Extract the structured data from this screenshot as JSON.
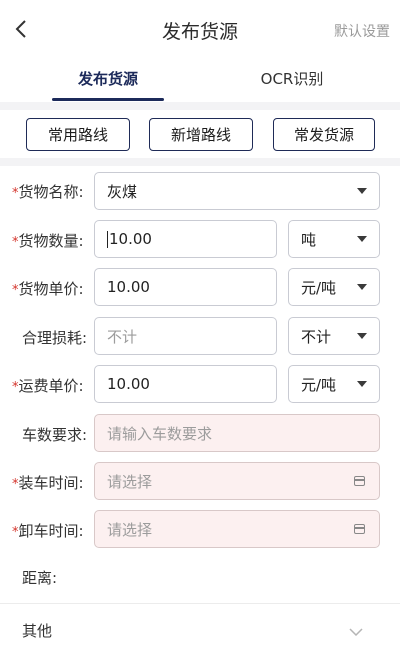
{
  "nav": {
    "title": "发布货源",
    "default_settings": "默认设置"
  },
  "tabs": [
    {
      "label": "发布货源",
      "active": true
    },
    {
      "label": "OCR识别",
      "active": false
    }
  ],
  "quick_buttons": [
    "常用路线",
    "新增路线",
    "常发货源"
  ],
  "required_mark": "*",
  "fields": {
    "cargo_name": {
      "label": "货物名称:",
      "value": "灰煤",
      "required": true
    },
    "cargo_qty": {
      "label": "货物数量:",
      "value": "10.00",
      "unit": "吨",
      "required": true
    },
    "cargo_price": {
      "label": "货物单价:",
      "value": "10.00",
      "unit": "元/吨",
      "required": true
    },
    "loss": {
      "label": "合理损耗:",
      "placeholder": "不计",
      "unit": "不计",
      "required": false
    },
    "freight_price": {
      "label": "运费单价:",
      "value": "10.00",
      "unit": "元/吨",
      "required": true
    },
    "truck_req": {
      "label": "车数要求:",
      "placeholder": "请输入车数要求",
      "required": false
    },
    "load_time": {
      "label": "装车时间:",
      "placeholder": "请选择",
      "required": true
    },
    "unload_time": {
      "label": "卸车时间:",
      "placeholder": "请选择",
      "required": true
    },
    "distance": {
      "label": "距离:"
    }
  },
  "other": {
    "label": "其他"
  },
  "colors": {
    "primary": "#1c2a5a",
    "required": "#d4332b",
    "pink_field": "#fcf0f0"
  },
  "icons": {
    "back": "chevron-left-icon",
    "dropdown": "caret-down-icon",
    "calendar": "calendar-icon",
    "expand": "chevron-down-icon"
  }
}
